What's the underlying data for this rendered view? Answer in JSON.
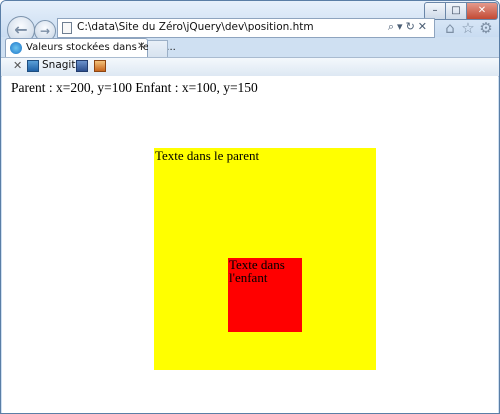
{
  "browser": {
    "address": "C:\\data\\Site du Zéro\\jQuery\\dev\\position.htm",
    "tab_title": "Valeurs stockées dans les él...",
    "window_controls": {
      "minimize": "–",
      "maximize": "□",
      "close": "✕"
    },
    "toolbar_icons": [
      "home-icon",
      "star-icon",
      "gear-icon"
    ],
    "command_bar": {
      "close_label": "✕",
      "snagit_label": "Snagit"
    }
  },
  "page": {
    "positions_text": "Parent : x=200, y=100 Enfant : x=100, y=150",
    "parent": {
      "text": "Texte dans le parent",
      "color": "#ffff00"
    },
    "child": {
      "text": "Texte dans l'enfant",
      "color": "#ff0000"
    }
  }
}
